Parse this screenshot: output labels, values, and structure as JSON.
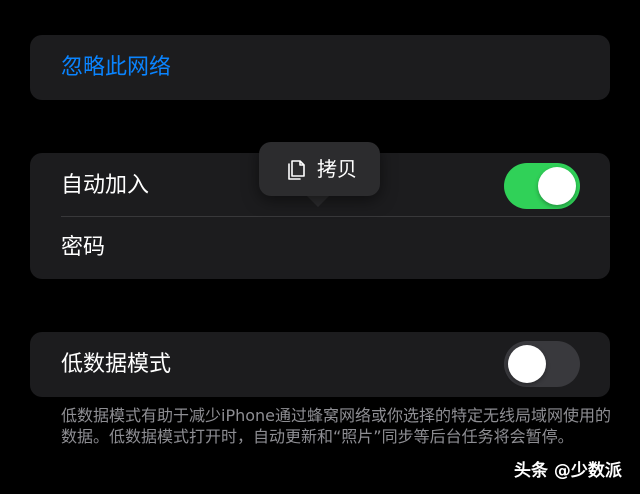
{
  "forget_network": {
    "label": "忽略此网络"
  },
  "join_group": {
    "auto_join_label": "自动加入",
    "auto_join_enabled": true,
    "password_label": "密码"
  },
  "context_menu": {
    "copy_icon": "copy-icon",
    "copy_label": "拷贝"
  },
  "low_data": {
    "label": "低数据模式",
    "enabled": false,
    "description": "低数据模式有助于减少iPhone通过蜂窝网络或你选择的特定无线局域网使用的数据。低数据模式打开时，自动更新和“照片”同步等后台任务将会暂停。"
  },
  "watermark": {
    "text": "头条 @少数派"
  },
  "colors": {
    "accent_blue": "#0a84ff",
    "toggle_on": "#30d158",
    "toggle_off": "#39393d",
    "card_bg": "#1c1c1e",
    "popup_bg": "#2c2c2e",
    "footnote": "#8e8e93"
  }
}
